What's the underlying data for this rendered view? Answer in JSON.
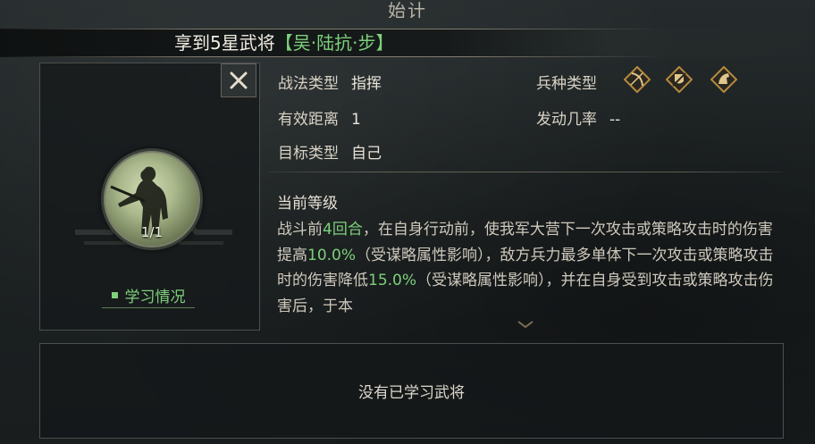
{
  "header": {
    "title": "始计",
    "banner_prefix": "享到5星武将",
    "banner_tag": "【吴·陆抗·步】"
  },
  "general": {
    "count": "1/1",
    "study_label": "学习情况"
  },
  "tactic": {
    "type_label": "战法类型",
    "type_value": "指挥",
    "range_label": "有效距离",
    "range_value": "1",
    "target_label": "目标类型",
    "target_value": "自己",
    "troop_label": "兵种类型",
    "troop_icons": [
      "bow-cavalry-icon",
      "shield-infantry-icon",
      "horse-cavalry-icon"
    ],
    "trigger_label": "发动几率",
    "trigger_value": "--"
  },
  "level": {
    "title": "当前等级",
    "desc_parts": [
      "战斗前",
      "4回合",
      "，在自身行动前，使我军大营下一次攻击或策略攻击时的伤害提高",
      "10.0%",
      "（受谋略属性影响），敌方兵力最多单体下一次攻击或策略攻击时的伤害降低",
      "15.0%",
      "（受谋略属性影响），并在自身受到攻击或策略攻击伤害后，于本"
    ]
  },
  "learned": {
    "empty_text": "没有已学习武将"
  },
  "colors": {
    "highlight": "#7dd07c",
    "text": "#cfc9bd",
    "panel_border": "#4b4f4d"
  }
}
